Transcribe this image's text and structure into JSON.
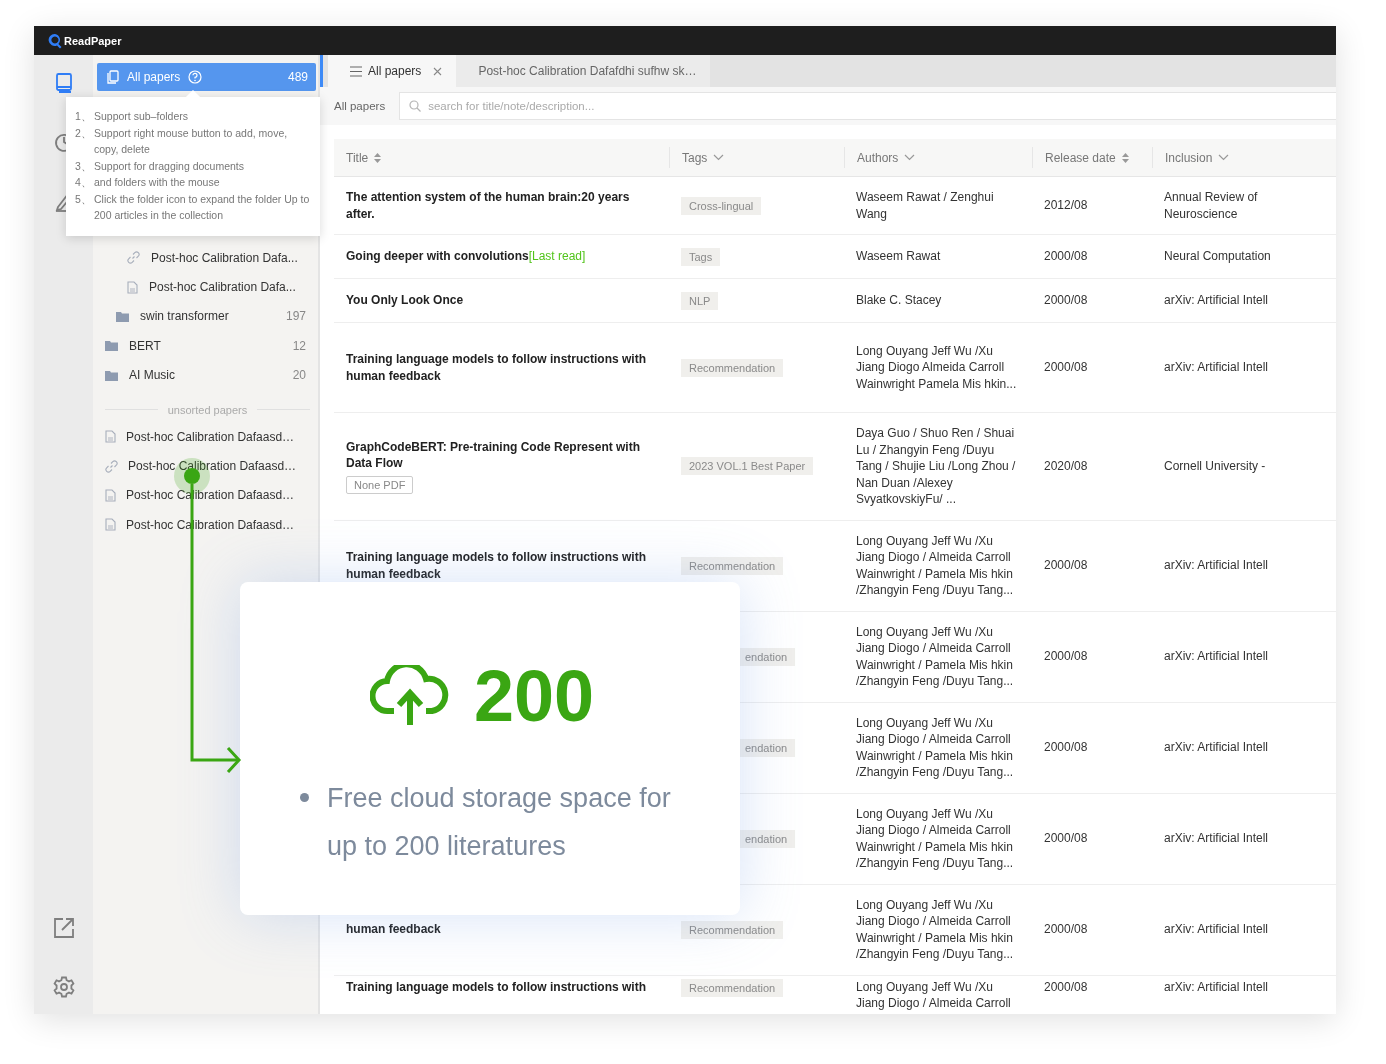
{
  "app": {
    "name": "ReadPaper"
  },
  "rail": {
    "top": [
      {
        "kind": "library",
        "selected": true
      },
      {
        "kind": "history",
        "selected": false
      },
      {
        "kind": "notes",
        "selected": false
      }
    ],
    "bottom": [
      {
        "kind": "export"
      },
      {
        "kind": "settings"
      }
    ]
  },
  "sidebar": {
    "all_papers": {
      "label": "All papers",
      "count": "489",
      "selected": true
    },
    "tooltip": [
      {
        "number": "1、",
        "text": "Support sub–folders"
      },
      {
        "number": "2、",
        "text": "Support right mouse button to add, move, copy, delete"
      },
      {
        "number": "3、",
        "text": "Support for dragging documents"
      },
      {
        "number": "4、",
        "text": "and folders with the mouse"
      },
      {
        "number": "5、",
        "text": "Click the folder icon to expand the folder Up to 200 articles in the collection"
      }
    ],
    "tree": [
      {
        "children": [
          {
            "children": [
              {
                "kind": "link",
                "label": "Post-hoc Calibration Dafa..."
              },
              {
                "kind": "pdf",
                "label": "Post-hoc Calibration Dafa..."
              }
            ]
          },
          {
            "kind": "folder",
            "label": "swin transformer",
            "count": "197"
          }
        ]
      },
      {
        "kind": "folder",
        "label": "BERT",
        "count": "12"
      },
      {
        "kind": "folder",
        "label": "AI Music",
        "count": "20"
      }
    ],
    "unsorted_label": "unsorted papers",
    "unsorted": [
      {
        "kind": "pdf",
        "label": "Post-hoc Calibration Dafaasd…"
      },
      {
        "kind": "link",
        "label": "Post-hoc Calibration Dafaasd…"
      },
      {
        "kind": "pdf",
        "label": "Post-hoc Calibration Dafaasd…"
      },
      {
        "kind": "pdf",
        "label": "Post-hoc Calibration Dafaasd…"
      }
    ]
  },
  "tabs": [
    {
      "label": "All papers",
      "selected": true,
      "closable": true
    },
    {
      "label": "Post-hoc Calibration Dafafdhi sufhw sk…",
      "selected": false,
      "closable": false
    }
  ],
  "toolbar": {
    "label": "All papers",
    "search": {
      "placeholder": "search for title/note/description..."
    }
  },
  "table": {
    "columns": [
      {
        "label": "Title",
        "sortable": true
      },
      {
        "label": "Tags",
        "sortable": false
      },
      {
        "label": "Authors",
        "sortable": false
      },
      {
        "label": "Release date",
        "sortable": true
      },
      {
        "label": "Inclusion",
        "sortable": false
      }
    ],
    "rows": [
      {
        "kind": "full",
        "title": "The attention system of the human brain:20 years after.",
        "tag": "Cross-lingual",
        "authors": "Waseem Rawat / Zenghui Wang",
        "date": "2012/08",
        "inclusion": "Annual Review of Neuroscience"
      },
      {
        "kind": "full",
        "title": "Going deeper with convolutions",
        "badge": "[Last read]",
        "tag": "Tags",
        "authors": "Waseem Rawat",
        "date": "2000/08",
        "inclusion": "Neural Computation"
      },
      {
        "kind": "full",
        "title": "You Only Look Once",
        "tag": "NLP",
        "authors": "Blake C. Stacey",
        "date": "2000/08",
        "inclusion": "arXiv: Artificial Intell"
      },
      {
        "kind": "full",
        "title": "Training language models to follow instructions with human feedback",
        "tag": "Recommendation",
        "authors": "Long Ouyang Jeff Wu /Xu Jiang Diogo Almeida Carroll Wainwright Pamela Mis hkin...",
        "date": "2000/08",
        "inclusion": "arXiv: Artificial Intell"
      },
      {
        "kind": "full",
        "title": "GraphCodeBERT: Pre-training Code Represent with Data Flow",
        "note": "None PDF",
        "tag": "2023 VOL.1 Best Paper",
        "authors": "Daya Guo / Shuo Ren /  Shuai Lu / Zhangyin Feng /Duyu Tang / Shujie Liu /Long Zhou / Nan Duan /Alexey SvyatkovskiyFu/ ...",
        "date": "2020/08",
        "inclusion": "Cornell University -"
      },
      {
        "kind": "full",
        "title": "Training language models to follow instructions with human feedback",
        "tag": "Recommendation",
        "authors": "Long Ouyang Jeff Wu /Xu Jiang Diogo / Almeida Carroll Wainwright / Pamela Mis hkin /Zhangyin Feng /Duyu Tang...",
        "date": "2000/08",
        "inclusion": "arXiv: Artificial Intell"
      },
      {
        "kind": "covered",
        "tag": "endation",
        "authors": "Long Ouyang Jeff Wu /Xu Jiang Diogo / Almeida Carroll Wainwright / Pamela Mis hkin /Zhangyin Feng /Duyu Tang...",
        "date": "2000/08",
        "inclusion": "arXiv: Artificial Intell"
      },
      {
        "kind": "covered",
        "tag": "endation",
        "authors": "Long Ouyang Jeff Wu /Xu Jiang Diogo / Almeida Carroll Wainwright / Pamela Mis hkin /Zhangyin Feng /Duyu Tang...",
        "date": "2000/08",
        "inclusion": "arXiv: Artificial Intell"
      },
      {
        "kind": "covered",
        "tag": "endation",
        "authors": "Long Ouyang Jeff Wu /Xu Jiang Diogo / Almeida Carroll Wainwright / Pamela Mis hkin /Zhangyin Feng /Duyu Tang...",
        "date": "2000/08",
        "inclusion": "arXiv: Artificial Intell"
      },
      {
        "kind": "full",
        "title": "human feedback",
        "tag": "Recommendation",
        "authors": "Long Ouyang Jeff Wu /Xu Jiang Diogo / Almeida Carroll Wainwright / Pamela Mis hkin /Zhangyin Feng /Duyu Tang...",
        "date": "2000/08",
        "inclusion": "arXiv: Artificial Intell"
      },
      {
        "kind": "top",
        "title": "Training language models to follow instructions with",
        "tag": "Recommendation",
        "authors": "Long Ouyang Jeff Wu /Xu Jiang Diogo / Almeida Carroll",
        "date": "2000/08",
        "inclusion": "arXiv: Artificial Intell"
      }
    ]
  },
  "promo": {
    "number": "200",
    "text": "Free cloud storage space for up to 200 literatures"
  }
}
